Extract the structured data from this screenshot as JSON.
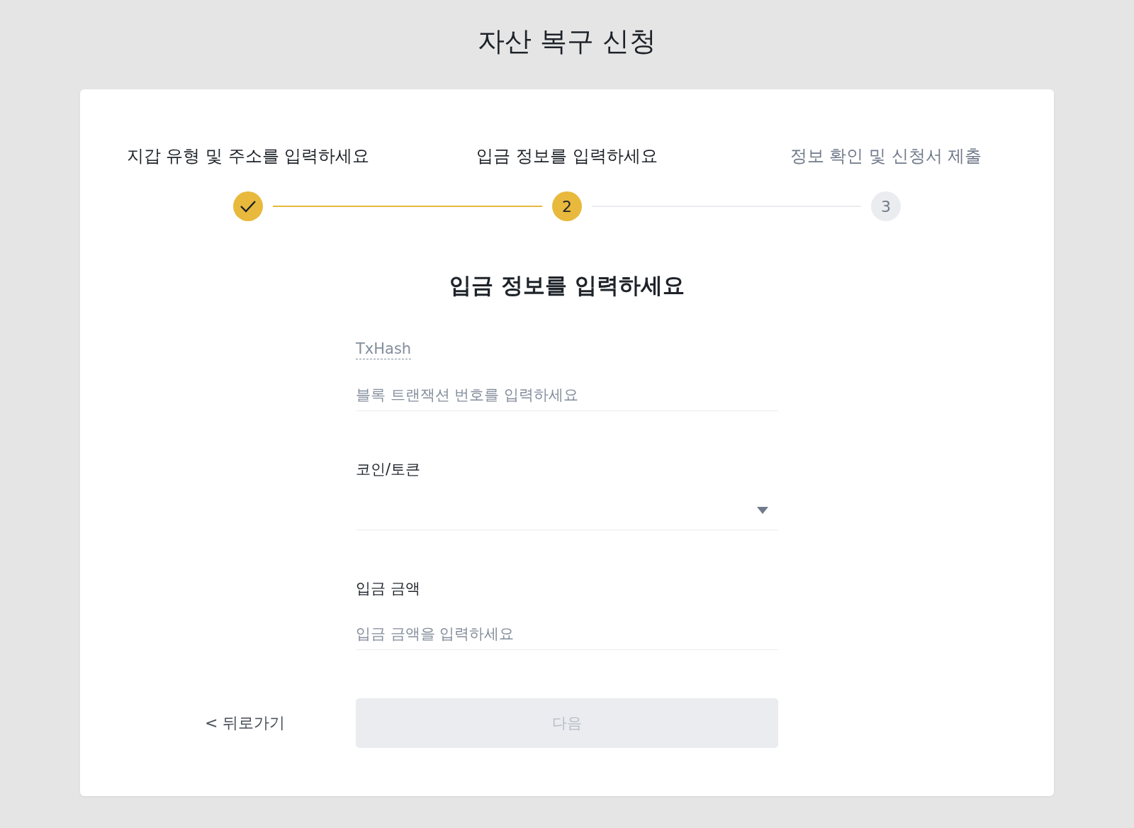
{
  "page": {
    "title": "자산 복구 신청"
  },
  "steps": [
    {
      "label": "지갑 유형 및 주소를 입력하세요",
      "completed": true,
      "selected": false
    },
    {
      "label": "입금 정보를 입력하세요",
      "completed": false,
      "selected": true,
      "number": "2"
    },
    {
      "label": "정보 확인 및 신청서 제출",
      "completed": false,
      "selected": false,
      "number": "3"
    }
  ],
  "form": {
    "heading": "입금 정보를 입력하세요",
    "fields": [
      {
        "kind": "input",
        "label": "TxHash",
        "has_tooltip": true,
        "placeholder": "블록 트랜잭션 번호를 입력하세요"
      },
      {
        "kind": "select",
        "label": "코인/토큰",
        "has_tooltip": false
      },
      {
        "kind": "input",
        "label": "입금 금액",
        "has_tooltip": false,
        "placeholder": "입금 금액을 입력하세요"
      }
    ],
    "back_link": "< 뒤로가기",
    "next_button": {
      "label": "다음",
      "disabled": true
    }
  }
}
